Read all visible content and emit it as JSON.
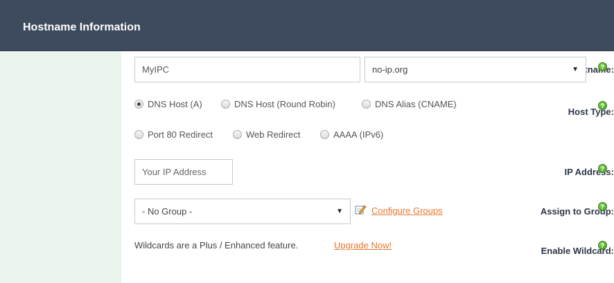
{
  "header": {
    "title": "Hostname Information"
  },
  "hostname": {
    "label": "Hostname:",
    "value": "MyIPC",
    "domain": "no-ip.org"
  },
  "host_type": {
    "label": "Host Type:",
    "options": [
      {
        "label": "DNS Host (A)",
        "checked": true
      },
      {
        "label": "DNS Host (Round Robin)",
        "checked": false
      },
      {
        "label": "DNS Alias (CNAME)",
        "checked": false
      },
      {
        "label": "Port 80 Redirect",
        "checked": false
      },
      {
        "label": "Web Redirect",
        "checked": false
      },
      {
        "label": "AAAA (IPv6)",
        "checked": false
      }
    ]
  },
  "ip_address": {
    "label": "IP Address:",
    "placeholder": "Your IP Address"
  },
  "group": {
    "label": "Assign to Group:",
    "selected": "- No Group -",
    "configure_link": "Configure Groups"
  },
  "wildcard": {
    "label": "Enable Wildcard:",
    "text": "Wildcards are a Plus / Enhanced feature.",
    "link": "Upgrade Now!"
  },
  "icons": {
    "help": "question-mark-icon",
    "edit": "edit-pencil-icon",
    "dropdown": "caret-down-icon"
  },
  "colors": {
    "header_bg": "#3e4a5e",
    "label_bg": "#eaf3ec",
    "link": "#e8772e",
    "help_green": "#3f9a1c"
  }
}
